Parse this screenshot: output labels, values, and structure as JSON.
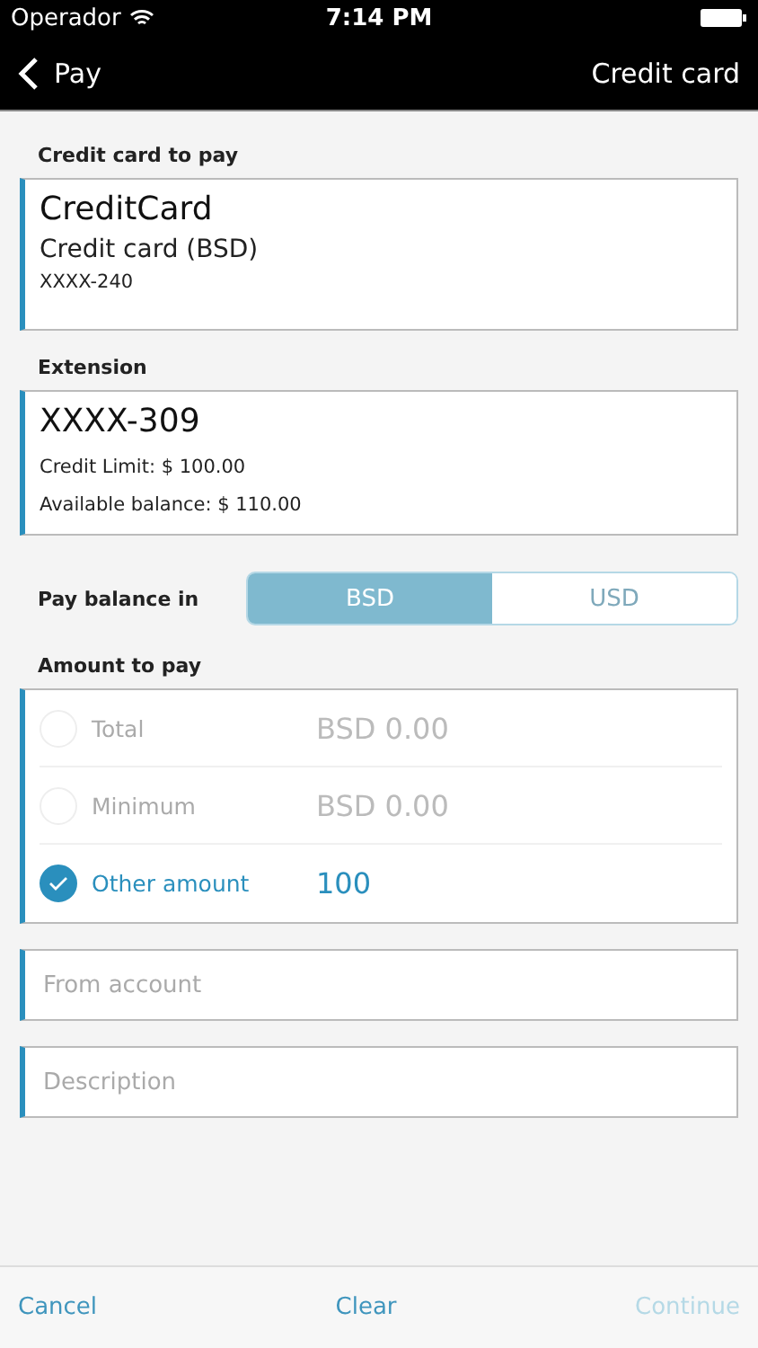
{
  "status_bar": {
    "carrier": "Operador",
    "time": "7:14 PM"
  },
  "nav": {
    "back": "Pay",
    "title": "Credit card"
  },
  "card_section": {
    "label": "Credit card to pay",
    "name": "CreditCard",
    "type": "Credit card (BSD)",
    "number": "XXXX-240"
  },
  "extension_section": {
    "label": "Extension",
    "number": "XXXX-309",
    "lines": [
      "Credit Limit: $ 100.00",
      "Available balance: $ 110.00"
    ]
  },
  "pay_balance": {
    "label": "Pay balance in",
    "options": [
      {
        "label": "BSD",
        "selected": true
      },
      {
        "label": "USD",
        "selected": false
      }
    ]
  },
  "amount": {
    "label": "Amount to pay",
    "options": [
      {
        "label": "Total",
        "value": "BSD 0.00",
        "selected": false
      },
      {
        "label": "Minimum",
        "value": "BSD 0.00",
        "selected": false
      },
      {
        "label": "Other amount",
        "value": "100",
        "selected": true
      }
    ]
  },
  "fields": [
    {
      "placeholder": "From account"
    },
    {
      "placeholder": "Description"
    }
  ],
  "footer": [
    {
      "label": "Cancel",
      "disabled": false
    },
    {
      "label": "Clear",
      "disabled": false
    },
    {
      "label": "Continue",
      "disabled": true
    }
  ]
}
